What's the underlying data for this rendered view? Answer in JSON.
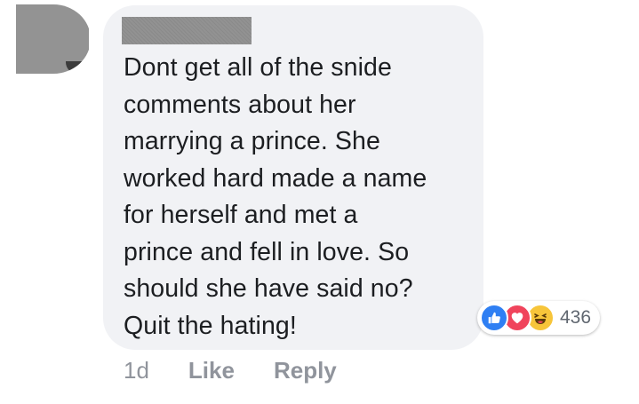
{
  "comment": {
    "lines": [
      "Dont get all of the snide",
      "comments about her",
      "marrying a prince. She",
      "worked hard made a name",
      "for herself and met a",
      "prince and fell in love. So",
      "should she have said no?",
      "Quit the hating!"
    ]
  },
  "reactions": {
    "icons": [
      "thumbs-up-icon",
      "heart-icon",
      "laughing-face-icon"
    ],
    "count": "436",
    "colors": {
      "like": "#2f7ff3",
      "love": "#f0445c",
      "haha": "#f7c53a"
    }
  },
  "actions": {
    "time": "1d",
    "like_label": "Like",
    "reply_label": "Reply"
  },
  "colors": {
    "bubble": "#f1f2f5",
    "text": "#1c1e21",
    "meta": "#90949c"
  }
}
